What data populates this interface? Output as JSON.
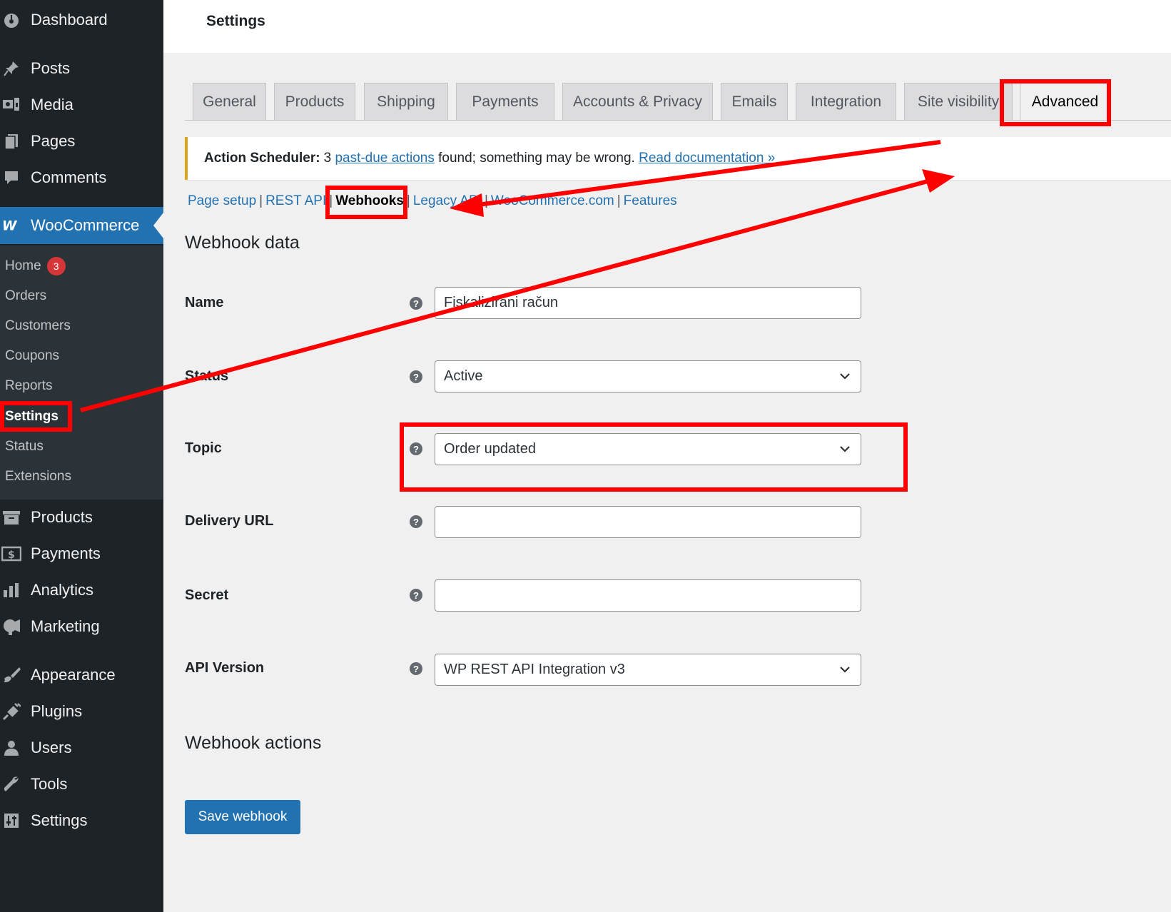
{
  "sidebar": {
    "dashboard": "Dashboard",
    "posts": "Posts",
    "media": "Media",
    "pages": "Pages",
    "comments": "Comments",
    "woocommerce": "WooCommerce",
    "woo_submenu": {
      "home": "Home",
      "home_badge": "3",
      "orders": "Orders",
      "customers": "Customers",
      "coupons": "Coupons",
      "reports": "Reports",
      "settings": "Settings",
      "status": "Status",
      "extensions": "Extensions"
    },
    "products": "Products",
    "payments": "Payments",
    "analytics": "Analytics",
    "marketing": "Marketing",
    "appearance": "Appearance",
    "plugins": "Plugins",
    "users": "Users",
    "tools": "Tools",
    "settings": "Settings"
  },
  "header": {
    "title": "Settings"
  },
  "tabs": [
    "General",
    "Products",
    "Shipping",
    "Payments",
    "Accounts & Privacy",
    "Emails",
    "Integration",
    "Site visibility",
    "Advanced"
  ],
  "active_tab": "Advanced",
  "notice": {
    "label": "Action Scheduler:",
    "count": "3",
    "link1": "past-due actions",
    "text": "found; something may be wrong.",
    "link2": "Read documentation »"
  },
  "subnav": {
    "page_setup": "Page setup",
    "rest_api": "REST API",
    "webhooks": "Webhooks",
    "legacy_api": "Legacy API",
    "woocommerce_com": "WooCommerce.com",
    "features": "Features",
    "separator": "|"
  },
  "webhook_data": {
    "heading": "Webhook data",
    "name_label": "Name",
    "name_value": "Fiskalizirani račun",
    "status_label": "Status",
    "status_value": "Active",
    "topic_label": "Topic",
    "topic_value": "Order updated",
    "delivery_url_label": "Delivery URL",
    "delivery_url_value": "",
    "secret_label": "Secret",
    "secret_value": "",
    "api_version_label": "API Version",
    "api_version_value": "WP REST API Integration v3",
    "help_glyph": "?"
  },
  "webhook_actions": {
    "heading": "Webhook actions",
    "save_label": "Save webhook"
  },
  "colors": {
    "sidebar_bg": "#1d2327",
    "submenu_bg": "#2c3338",
    "accent": "#2271b1",
    "annotation": "#ff0000",
    "notice_border": "#dba617",
    "badge": "#d63638"
  }
}
